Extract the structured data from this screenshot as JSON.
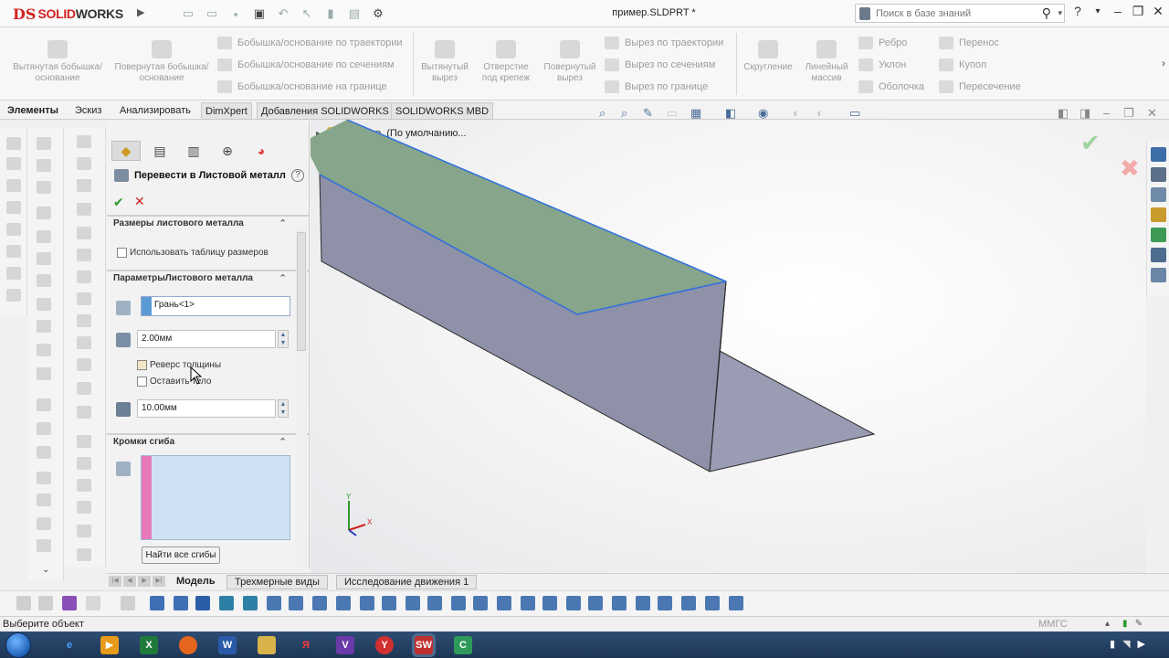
{
  "titlebar": {
    "brand_ds": "DS",
    "brand_solid": "SOLID",
    "brand_works": "WORKS",
    "doc_title": "пример.SLDPRT *",
    "search_placeholder": "Поиск в базе знаний",
    "help": "?"
  },
  "ribbon": {
    "extruded_boss": "Вытянутая бобышка/основание",
    "revolved_boss": "Повернутая бобышка/основание",
    "swept_boss": "Бобышка/основание по траектории",
    "lofted_boss": "Бобышка/основание по сечениям",
    "boundary_boss": "Бобышка/основание на границе",
    "extruded_cut": "Вытянутый вырез",
    "hole_wizard": "Отверстие под крепеж",
    "revolved_cut": "Повернутый вырез",
    "swept_cut": "Вырез по траектории",
    "lofted_cut": "Вырез по сечениям",
    "boundary_cut": "Вырез по границе",
    "fillet": "Скругление",
    "linear_pattern": "Линейный массив",
    "rib": "Ребро",
    "draft": "Уклон",
    "shell": "Оболочка",
    "wrap": "Перенос",
    "dome": "Купол",
    "intersect": "Пересечение"
  },
  "tabs": [
    "Элементы",
    "Эскиз",
    "Анализировать",
    "DimXpert",
    "Добавления SOLIDWORKS",
    "SOLIDWORKS MBD"
  ],
  "property_manager": {
    "title": "Перевести в Листовой металл",
    "group_gauges": "Размеры листового металла",
    "use_gauge_table": "Использовать таблицу размеров",
    "group_parameters": "ПараметрыЛистового металла",
    "face_value": "Грань<1>",
    "thickness": "2.00мм",
    "reverse_thickness": "Реверс толщины",
    "keep_body": "Оставить тело",
    "radius": "10.00мм",
    "group_bend_edges": "Кромки сгиба",
    "find_bends": "Найти все сгибы"
  },
  "tree": {
    "item": "пример",
    "config": "(По умолчанию..."
  },
  "bottom_tabs": [
    "Модель",
    "Трехмерные виды",
    "Исследование движения 1"
  ],
  "statusbar": {
    "message": "Выберите объект",
    "units": "ММГС"
  },
  "colors": {
    "top_face": "#86a58a",
    "side_face": "#8e91a8",
    "flange_face": "#9a9cb4",
    "edge_highlight": "#2f6fe0",
    "accent_red": "#d12323"
  }
}
